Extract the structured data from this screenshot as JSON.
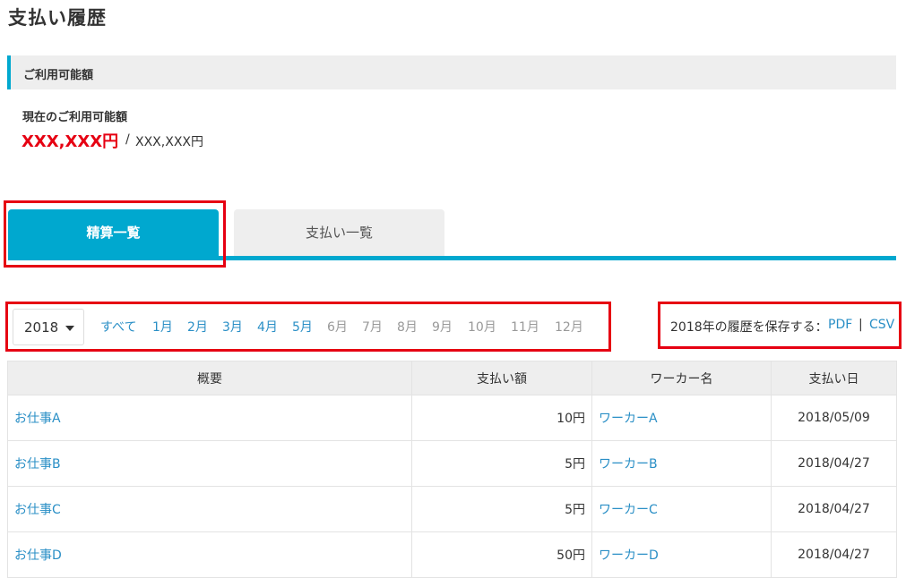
{
  "page": {
    "title": "支払い履歴"
  },
  "available": {
    "section_title": "ご利用可能額",
    "label": "現在のご利用可能額",
    "amount": "XXX,XXX円",
    "separator": "/",
    "total": "XXX,XXX円"
  },
  "tabs": [
    {
      "label": "精算一覧",
      "active": true
    },
    {
      "label": "支払い一覧",
      "active": false
    }
  ],
  "filter": {
    "year": "2018",
    "months": [
      {
        "label": "すべて",
        "enabled": true
      },
      {
        "label": "1月",
        "enabled": true
      },
      {
        "label": "2月",
        "enabled": true
      },
      {
        "label": "3月",
        "enabled": true
      },
      {
        "label": "4月",
        "enabled": true
      },
      {
        "label": "5月",
        "enabled": true
      },
      {
        "label": "6月",
        "enabled": false
      },
      {
        "label": "7月",
        "enabled": false
      },
      {
        "label": "8月",
        "enabled": false
      },
      {
        "label": "9月",
        "enabled": false
      },
      {
        "label": "10月",
        "enabled": false
      },
      {
        "label": "11月",
        "enabled": false
      },
      {
        "label": "12月",
        "enabled": false
      }
    ]
  },
  "save": {
    "label": "2018年の履歴を保存する：",
    "pdf": "PDF",
    "separator": "|",
    "csv": "CSV"
  },
  "table": {
    "headers": [
      "概要",
      "支払い額",
      "ワーカー名",
      "支払い日"
    ],
    "rows": [
      {
        "title": "お仕事A",
        "amount": "10円",
        "worker": "ワーカーA",
        "date": "2018/05/09"
      },
      {
        "title": "お仕事B",
        "amount": "5円",
        "worker": "ワーカーB",
        "date": "2018/04/27"
      },
      {
        "title": "お仕事C",
        "amount": "5円",
        "worker": "ワーカーC",
        "date": "2018/04/27"
      },
      {
        "title": "お仕事D",
        "amount": "50円",
        "worker": "ワーカーD",
        "date": "2018/04/27"
      }
    ]
  },
  "colors": {
    "accent": "#00a8cf",
    "link": "#2a8fc6",
    "highlight": "#e60012",
    "header_bg": "#eeeeee"
  }
}
